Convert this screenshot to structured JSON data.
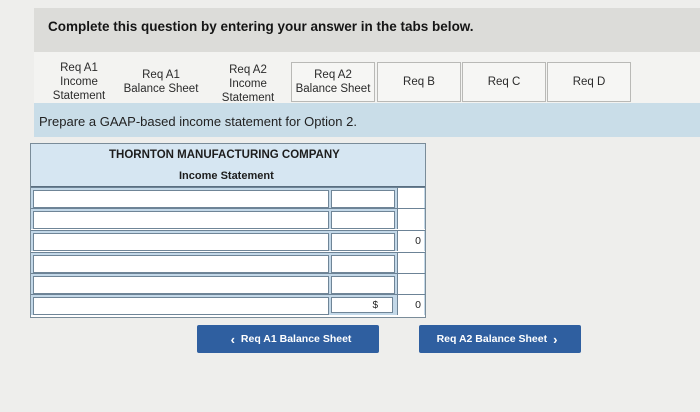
{
  "instruction": "Complete this question by entering your answer in the tabs below.",
  "tabs": [
    {
      "label": "Req A1\nIncome\nStatement",
      "active": true
    },
    {
      "label": "Req A1\nBalance Sheet",
      "active": false
    },
    {
      "label": "Req A2\nIncome\nStatement",
      "active": true
    },
    {
      "label": "Req A2\nBalance Sheet",
      "active": false
    },
    {
      "label": "Req B",
      "active": false
    },
    {
      "label": "Req C",
      "active": false
    },
    {
      "label": "Req D",
      "active": false
    }
  ],
  "prompt": "Prepare a GAAP-based income statement for Option 2.",
  "statement": {
    "company": "THORNTON MANUFACTURING COMPANY",
    "title": "Income Statement",
    "rows": [
      {
        "desc": "",
        "amount": "",
        "total": ""
      },
      {
        "desc": "",
        "amount": "",
        "total": ""
      },
      {
        "desc": "",
        "amount": "",
        "total": "0"
      },
      {
        "desc": "",
        "amount": "",
        "total": ""
      },
      {
        "desc": "",
        "amount": "",
        "total": ""
      },
      {
        "desc": "",
        "amount": "$",
        "total": "0"
      }
    ]
  },
  "nav": {
    "prev_label": "Req A1 Balance Sheet",
    "next_label": "Req A2 Balance Sheet",
    "prev_icon": "chevron-left-icon",
    "next_icon": "chevron-right-icon"
  },
  "colors": {
    "button": "#2f5fa0",
    "prompt_band": "#c9dde8",
    "table_header": "#d6e6f2"
  }
}
